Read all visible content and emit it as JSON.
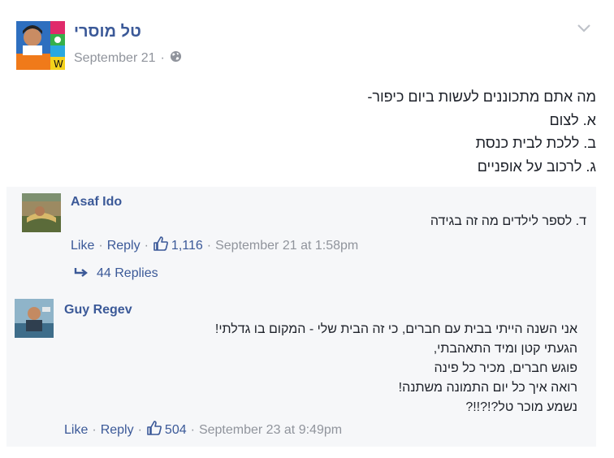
{
  "post": {
    "author": "טל מוסרי",
    "date": "September 21",
    "meta_separator": "·",
    "lines": [
      "מה אתם מתכוננים לעשות ביום כיפור-",
      "א. לצום",
      "ב. ללכת לבית כנסת",
      "ג. לרכוב על אופניים"
    ]
  },
  "comments": [
    {
      "author": "Asaf Ido",
      "lines": [
        "ד. לספר לילדים מה זה בגידה"
      ],
      "like_label": "Like",
      "reply_label": "Reply",
      "likes": "1,116",
      "timestamp": "September 21 at 1:58pm",
      "replies": "44 Replies"
    },
    {
      "author": "Guy Regev",
      "lines": [
        "אני השנה הייתי בבית עם חברים, כי זה הבית שלי - המקום בו גדלתי!",
        "הגעתי קטן ומיד התאהבתי,",
        "פוגש חברים, מכיר כל פינה",
        "רואה איך כל יום התמונה משתנה!",
        "נשמע מוכר טל?!?!!?"
      ],
      "like_label": "Like",
      "reply_label": "Reply",
      "likes": "504",
      "timestamp": "September 23 at 9:49pm"
    }
  ],
  "icons": {
    "privacy": "globe-icon",
    "menu": "chevron-down-icon",
    "like": "thumbs-up-icon",
    "replies": "reply-arrow-icon"
  },
  "colors": {
    "link": "#3b5998",
    "meta": "#90949c",
    "comment_bg": "#f6f7f9",
    "text": "#1d2129"
  }
}
